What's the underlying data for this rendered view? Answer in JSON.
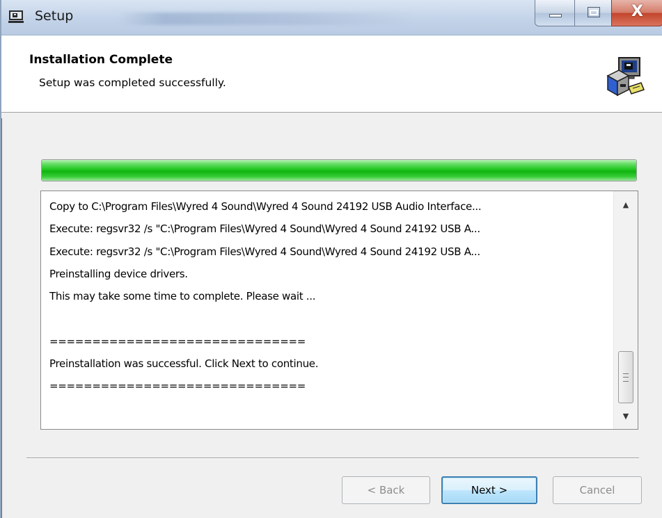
{
  "window": {
    "title": "Setup",
    "caption_buttons": {
      "minimize_icon": "minimize-icon",
      "maximize_icon": "maximize-icon",
      "close_glyph": "X"
    }
  },
  "header": {
    "title": "Installation Complete",
    "subtitle": "Setup was completed successfully.",
    "icon": "setup-computer-icon"
  },
  "progress": {
    "fraction": 1.0,
    "fill_color": "#22c722"
  },
  "log": {
    "lines": [
      "Copy to C:\\Program Files\\Wyred 4 Sound\\Wyred 4 Sound 24192 USB Audio Interface...",
      "Execute: regsvr32 /s \"C:\\Program Files\\Wyred 4 Sound\\Wyred 4 Sound 24192 USB A...",
      "Execute: regsvr32 /s \"C:\\Program Files\\Wyred 4 Sound\\Wyred 4 Sound 24192 USB A...",
      "Preinstalling device drivers.",
      "This may take some time to complete. Please wait ...",
      "",
      "==============================",
      "Preinstallation was successful. Click Next to continue.",
      "=============================="
    ]
  },
  "buttons": {
    "back": "< Back",
    "next": "Next >",
    "cancel": "Cancel"
  }
}
